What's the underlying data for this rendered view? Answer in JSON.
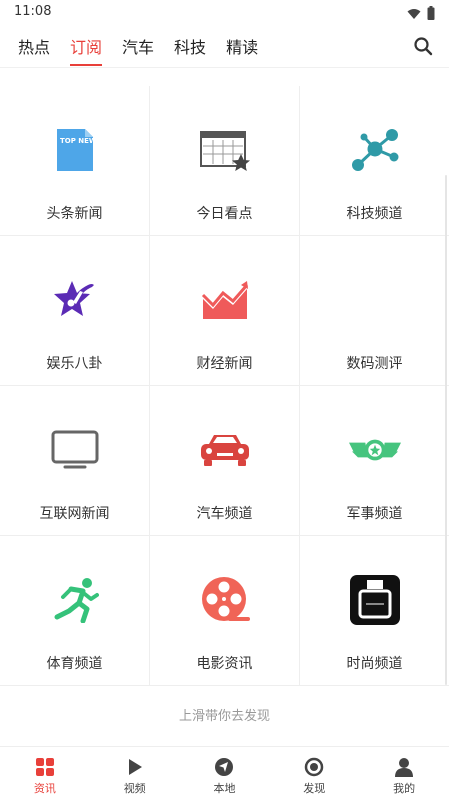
{
  "status_bar": {
    "time": "11:08"
  },
  "top_tabs": {
    "items": [
      {
        "label": "热点"
      },
      {
        "label": "订阅"
      },
      {
        "label": "汽车"
      },
      {
        "label": "科技"
      },
      {
        "label": "精读"
      }
    ],
    "active_index": 1
  },
  "channels": [
    {
      "label": "头条新闻",
      "icon": "top-news-icon",
      "icon_text": "TOP NEWS",
      "color": "#4ea6e8"
    },
    {
      "label": "今日看点",
      "icon": "calendar-star-icon",
      "color": "#555555"
    },
    {
      "label": "科技频道",
      "icon": "molecule-icon",
      "color": "#2f9aa7"
    },
    {
      "label": "娱乐八卦",
      "icon": "star-note-icon",
      "color": "#5b2bb5"
    },
    {
      "label": "财经新闻",
      "icon": "trend-chart-icon",
      "color": "#ef5a5a"
    },
    {
      "label": "数码测评",
      "icon": "blank",
      "color": "#ffffff"
    },
    {
      "label": "互联网新闻",
      "icon": "monitor-icon",
      "color": "#666666"
    },
    {
      "label": "汽车频道",
      "icon": "car-icon",
      "color": "#d9443f"
    },
    {
      "label": "军事频道",
      "icon": "military-badge-icon",
      "color": "#46c47e"
    },
    {
      "label": "体育频道",
      "icon": "running-man-icon",
      "color": "#35c27a"
    },
    {
      "label": "电影资讯",
      "icon": "film-reel-icon",
      "color": "#f06457"
    },
    {
      "label": "时尚频道",
      "icon": "perfume-icon",
      "color": "#111111"
    }
  ],
  "bottom_hint": "上滑带你去发现",
  "bottom_nav": {
    "items": [
      {
        "label": "资讯",
        "icon": "grid-icon"
      },
      {
        "label": "视频",
        "icon": "play-icon"
      },
      {
        "label": "本地",
        "icon": "location-arrow-icon"
      },
      {
        "label": "发现",
        "icon": "discover-ring-icon"
      },
      {
        "label": "我的",
        "icon": "user-icon"
      }
    ],
    "active_index": 0
  },
  "colors": {
    "accent": "#e8403a"
  }
}
